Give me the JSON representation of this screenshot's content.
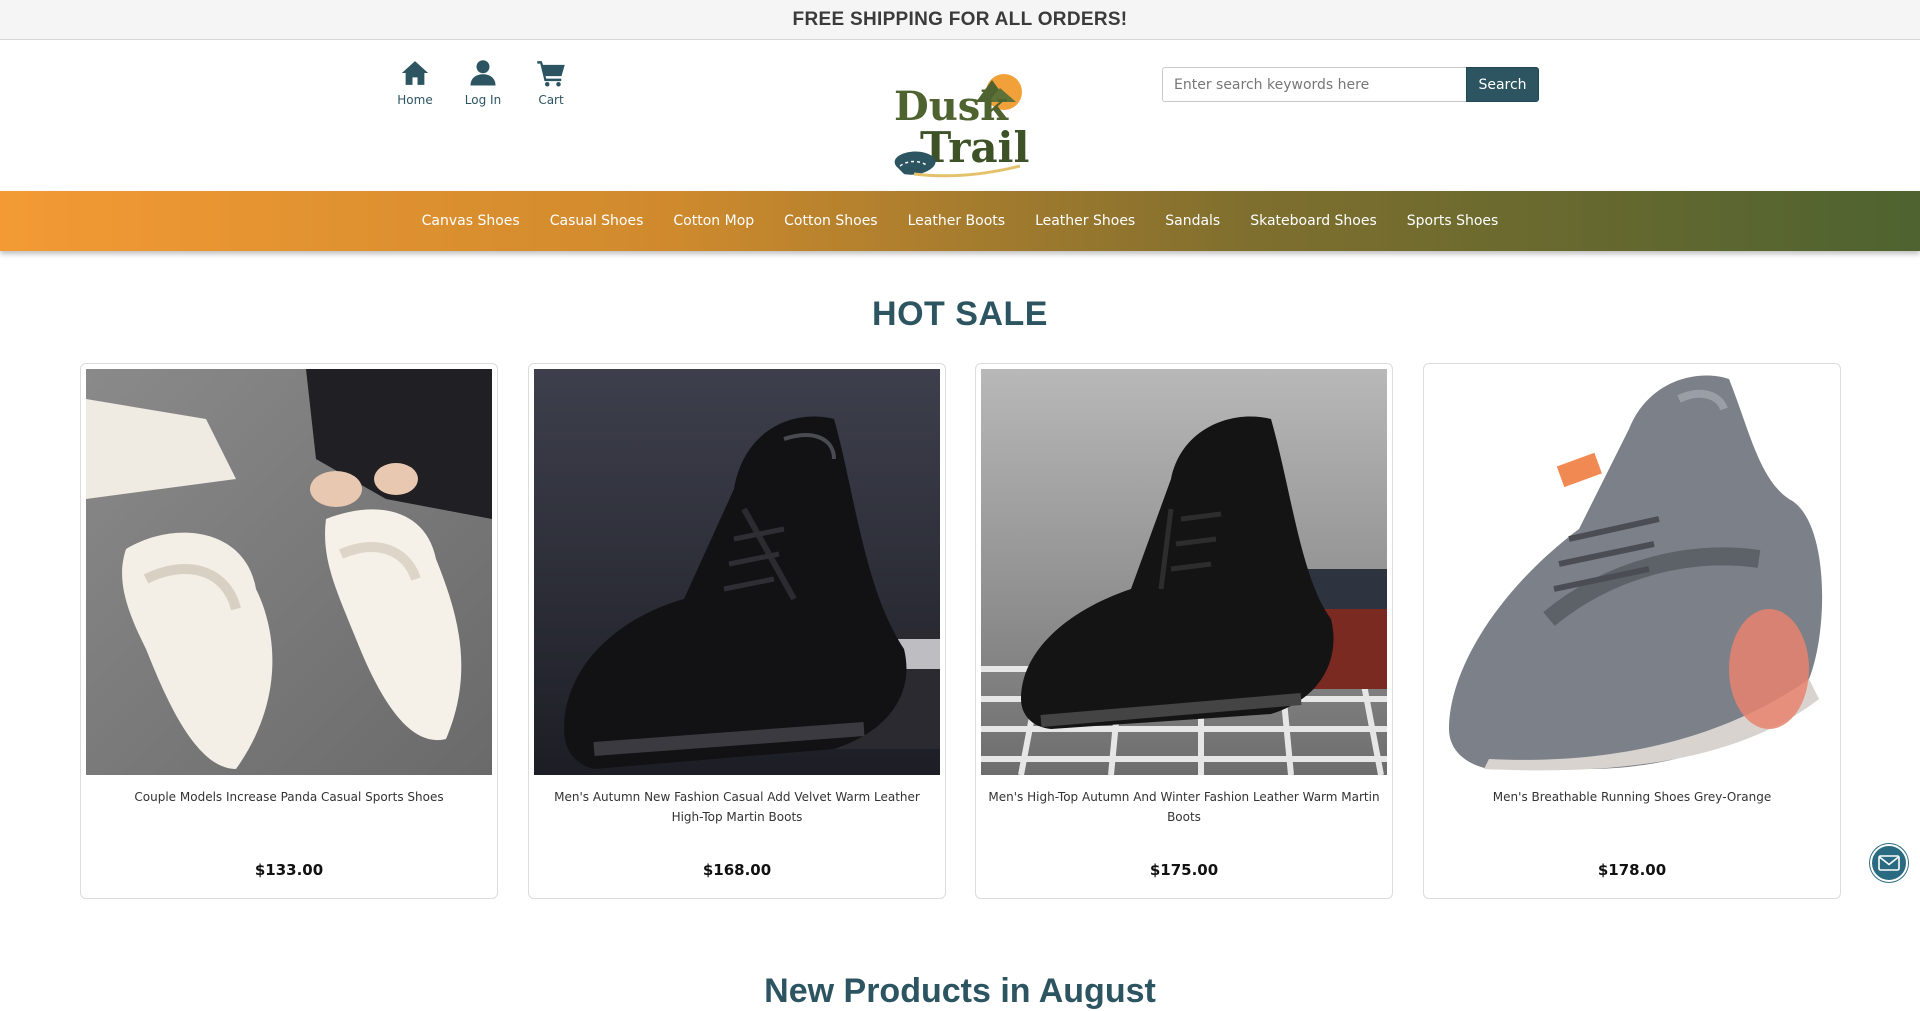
{
  "topbar": {
    "text": "FREE SHIPPING FOR ALL ORDERS!"
  },
  "header": {
    "quick_links": [
      {
        "label": "Home",
        "icon": "home-icon"
      },
      {
        "label": "Log In",
        "icon": "user-icon"
      },
      {
        "label": "Cart",
        "icon": "cart-icon"
      }
    ],
    "logo": {
      "line1": "Dusk",
      "line2": "Trail"
    },
    "search": {
      "placeholder": "Enter search keywords here",
      "value": "",
      "button_label": "Search"
    }
  },
  "nav": {
    "items": [
      "Canvas Shoes",
      "Casual Shoes",
      "Cotton Mop",
      "Cotton Shoes",
      "Leather Boots",
      "Leather Shoes",
      "Sandals",
      "Skateboard Shoes",
      "Sports Shoes"
    ]
  },
  "hot_sale": {
    "title": "HOT SALE",
    "products": [
      {
        "title": "Couple Models Increase Panda Casual Sports Shoes",
        "price": "$133.00"
      },
      {
        "title": "Men's Autumn New Fashion Casual Add Velvet Warm Leather High-Top Martin Boots",
        "price": "$168.00"
      },
      {
        "title": "Men's High-Top Autumn And Winter Fashion Leather Warm Martin Boots",
        "price": "$175.00"
      },
      {
        "title": "Men's Breathable Running Shoes Grey-Orange",
        "price": "$178.00"
      }
    ]
  },
  "new_products": {
    "title": "New Products in August"
  },
  "colors": {
    "brand": "#2c5561",
    "nav_start": "#f39a34",
    "nav_end": "#4e6330",
    "logo_orange": "#f2a13a",
    "logo_green": "#4e6330"
  }
}
